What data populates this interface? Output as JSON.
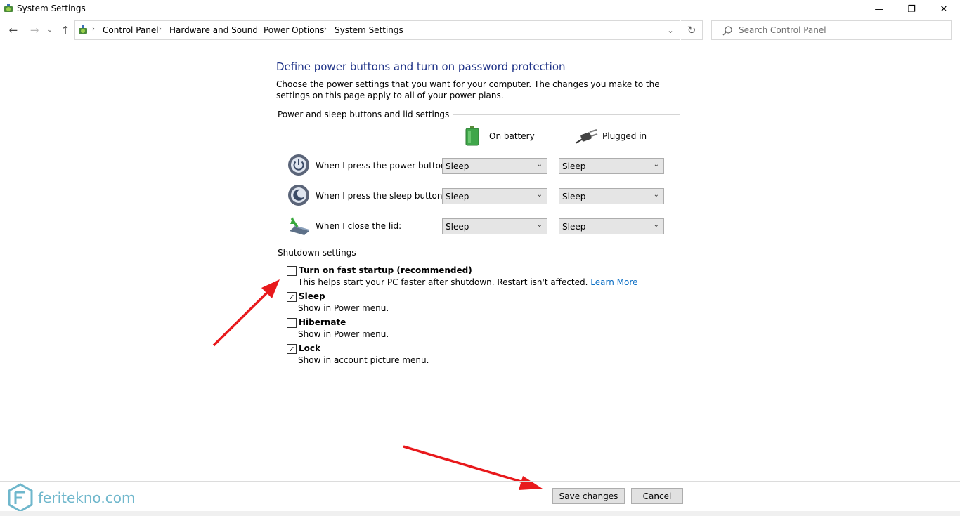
{
  "window": {
    "title": "System Settings",
    "controls": {
      "minimize": "—",
      "maximize": "❐",
      "close": "✕"
    }
  },
  "nav": {
    "back": "←",
    "forward": "→",
    "recent": "⌄",
    "up": "↑",
    "breadcrumbs": [
      "Control Panel",
      "Hardware and Sound",
      "Power Options",
      "System Settings"
    ],
    "separator": "›",
    "dropdown": "⌄",
    "refresh": "↻",
    "search_placeholder": "Search Control Panel"
  },
  "page": {
    "title": "Define power buttons and turn on password protection",
    "description": "Choose the power settings that you want for your computer. The changes you make to the settings on this page apply to all of your power plans."
  },
  "buttons_group": {
    "header": "Power and sleep buttons and lid settings",
    "columns": [
      "On battery",
      "Plugged in"
    ],
    "rows": [
      {
        "label": "When I press the power button:",
        "on_battery": "Sleep",
        "plugged_in": "Sleep",
        "icon": "power-button-icon"
      },
      {
        "label": "When I press the sleep button:",
        "on_battery": "Sleep",
        "plugged_in": "Sleep",
        "icon": "sleep-button-icon"
      },
      {
        "label": "When I close the lid:",
        "on_battery": "Sleep",
        "plugged_in": "Sleep",
        "icon": "laptop-lid-icon"
      }
    ]
  },
  "shutdown_group": {
    "header": "Shutdown settings",
    "items": [
      {
        "label": "Turn on fast startup (recommended)",
        "checked": false,
        "mark": "",
        "desc": "This helps start your PC faster after shutdown. Restart isn't affected.",
        "link": "Learn More"
      },
      {
        "label": "Sleep",
        "checked": true,
        "mark": "✓",
        "desc": "Show in Power menu."
      },
      {
        "label": "Hibernate",
        "checked": false,
        "mark": "",
        "desc": "Show in Power menu."
      },
      {
        "label": "Lock",
        "checked": true,
        "mark": "✓",
        "desc": "Show in account picture menu."
      }
    ]
  },
  "footer": {
    "save": "Save changes",
    "cancel": "Cancel"
  },
  "watermark": {
    "text": "feritekno.com"
  },
  "colors": {
    "title_blue": "#1e3287",
    "link_blue": "#0b6ec4",
    "arrow_red": "#e8191c",
    "watermark": "#6fb7cc"
  }
}
